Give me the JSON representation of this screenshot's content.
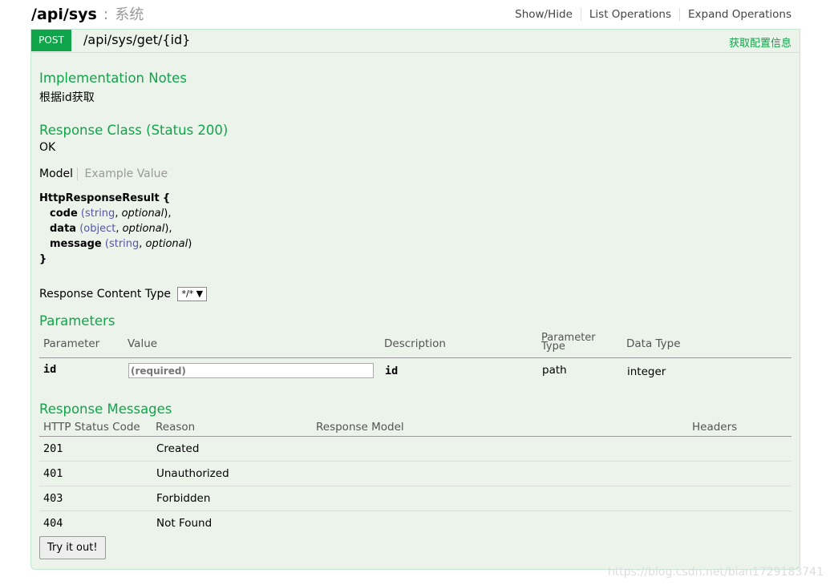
{
  "heading": {
    "path": "/api/sys",
    "separator": ":",
    "description": "系统"
  },
  "ops": [
    "Show/Hide",
    "List Operations",
    "Expand Operations"
  ],
  "operation": {
    "method": "POST",
    "path": "/api/sys/get/{id}",
    "summary": "获取配置信息",
    "impl_title": "Implementation Notes",
    "impl_text": "根据id获取",
    "resp_class_title": "Response Class (Status 200)",
    "resp_class_text": "OK",
    "model_tab": "Model",
    "example_tab": "Example Value",
    "model": {
      "name": "HttpResponseResult",
      "fields": [
        {
          "name": "code",
          "type": "string",
          "opt": "optional",
          "tail": "),"
        },
        {
          "name": "data",
          "type": "object",
          "opt": "optional",
          "tail": "),"
        },
        {
          "name": "message",
          "type": "string",
          "opt": "optional",
          "tail": ")"
        }
      ]
    },
    "rct_label": "Response Content Type",
    "rct_value": "*/*",
    "params_title": "Parameters",
    "params_headers": [
      "Parameter",
      "Value",
      "Description",
      "Parameter Type",
      "Data Type"
    ],
    "param": {
      "name": "id",
      "placeholder": "(required)",
      "desc": "id",
      "ptype": "path",
      "dtype": "integer"
    },
    "resp_title": "Response Messages",
    "resp_headers": [
      "HTTP Status Code",
      "Reason",
      "Response Model",
      "Headers"
    ],
    "responses": [
      {
        "code": "201",
        "reason": "Created"
      },
      {
        "code": "401",
        "reason": "Unauthorized"
      },
      {
        "code": "403",
        "reason": "Forbidden"
      },
      {
        "code": "404",
        "reason": "Not Found"
      }
    ],
    "try_label": "Try it out!"
  },
  "watermark": "https://blog.csdn.net/bian1729183741"
}
